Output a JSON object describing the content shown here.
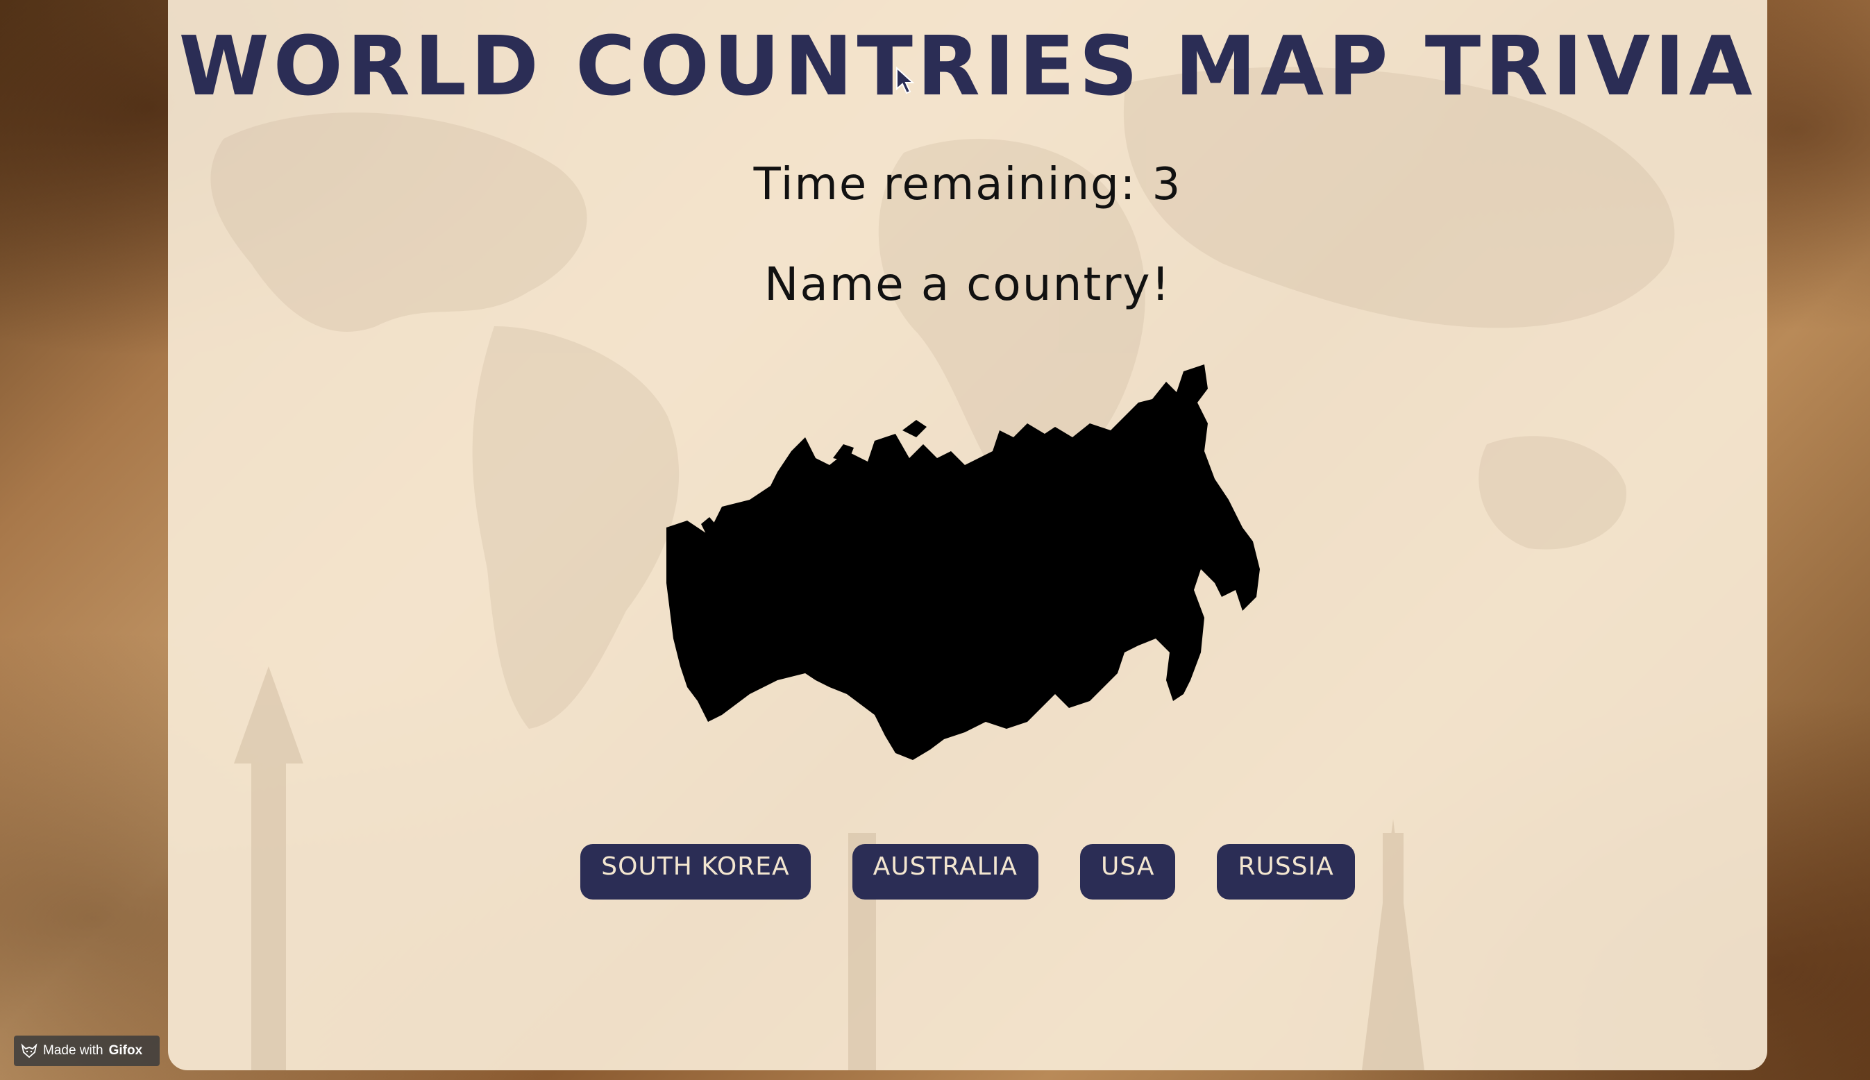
{
  "game": {
    "title": "WORLD COUNTRIES MAP TRIVIA",
    "timer_text": "Time remaining: 3",
    "prompt": "Name a country!",
    "silhouette_icon": "russia-silhouette",
    "answers": [
      {
        "label": "SOUTH KOREA"
      },
      {
        "label": "AUSTRALIA"
      },
      {
        "label": "USA"
      },
      {
        "label": "RUSSIA"
      }
    ]
  },
  "watermark": {
    "prefix": "Made with",
    "brand": "Gifox",
    "icon": "fox-icon"
  },
  "colors": {
    "title": "#2b2d55",
    "button_bg": "#2b2d55",
    "button_text": "#f3e6d0",
    "panel_bg": "#f6e8d3"
  }
}
